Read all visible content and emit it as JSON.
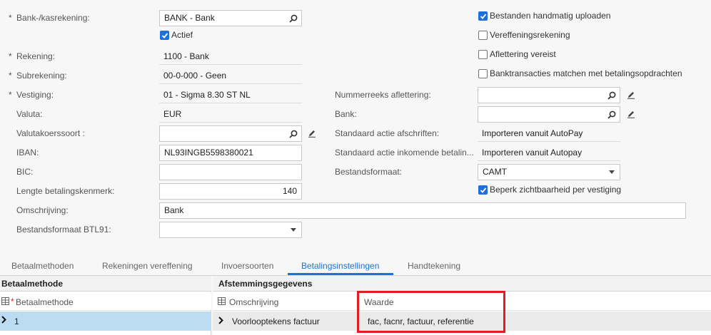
{
  "form": {
    "cash_account_label": "Bank-/kasrekening:",
    "cash_account_value": "BANK - Bank",
    "active_label": "Actief",
    "account_label": "Rekening:",
    "account_value": "1100 - Bank",
    "subaccount_label": "Subrekening:",
    "subaccount_value": "00-0-000 - Geen",
    "branch_label": "Vestiging:",
    "branch_value": "01 - Sigma 8.30 ST NL",
    "currency_label": "Valuta:",
    "currency_value": "EUR",
    "rate_type_label": "Valutakoerssoort :",
    "rate_type_value": "",
    "iban_label": "IBAN:",
    "iban_value": "NL93INGB5598380021",
    "bic_label": "BIC:",
    "bic_value": "",
    "payref_len_label": "Lengte betalingskenmerk:",
    "payref_len_value": "140",
    "description_label": "Omschrijving:",
    "description_value": "Bank",
    "btl91_label": "Bestandsformaat BTL91:",
    "btl91_value": ""
  },
  "middle": {
    "numbering_label": "Nummerreeks aflettering:",
    "numbering_value": "",
    "bank_label": "Bank:",
    "bank_value": "",
    "stmt_action_label": "Standaard actie afschriften:",
    "stmt_action_value": "Importeren vanuit AutoPay",
    "incoming_action_label": "Standaard actie inkomende betalin...",
    "incoming_action_value": "Importeren vanuit Autopay",
    "file_format_label": "Bestandsformaat:",
    "file_format_value": "CAMT",
    "restrict_label": "Beperk zichtbaarheid per vestiging"
  },
  "right": {
    "manual_upload_label": "Bestanden handmatig uploaden",
    "clearing_label": "Vereffeningsrekening",
    "reconcile_label": "Aflettering vereist",
    "match_label": "Banktransacties matchen met betalingsopdrachten"
  },
  "checkboxes": {
    "active": true,
    "manual_upload": true,
    "clearing": false,
    "reconcile": false,
    "match": false,
    "restrict": true
  },
  "tabs": [
    "Betaalmethoden",
    "Rekeningen vereffening",
    "Invoersoorten",
    "Betalingsinstellingen",
    "Handtekening"
  ],
  "active_tab": "Betalingsinstellingen",
  "left_grid": {
    "title": "Betaalmethode",
    "column": "Betaalmethode",
    "rows": [
      "1"
    ]
  },
  "right_grid": {
    "title": "Afstemmingsgegevens",
    "col1": "Omschrijving",
    "col2": "Waarde",
    "rows": [
      {
        "omschrijving": "Voorlooptekens factuur",
        "waarde": "fac, facnr, factuur, referentie"
      }
    ]
  },
  "colors": {
    "accent": "#1e6fd9",
    "highlight_border": "#e01e24",
    "selected_row": "#bcdcf4"
  }
}
